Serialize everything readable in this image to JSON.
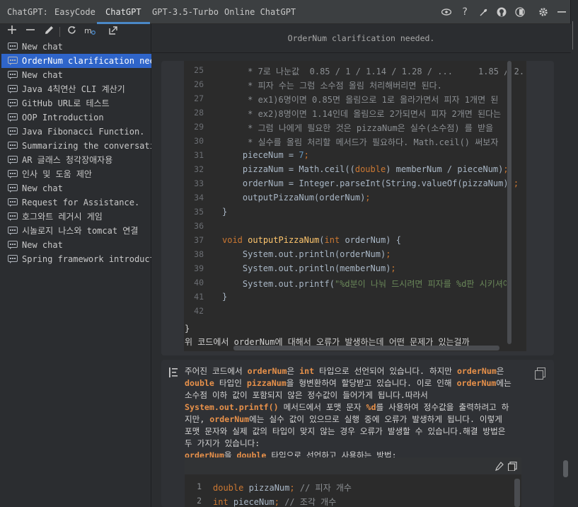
{
  "tabs": [
    "ChatGPT:",
    "EasyCode",
    "ChatGPT",
    "GPT-3.5-Turbo",
    "Online ChatGPT"
  ],
  "active_tab": 2,
  "icons": {
    "top": [
      "eye-icon",
      "help-icon",
      "wrench-icon",
      "github-icon",
      "plugin-icon",
      "gear-icon",
      "minimize-icon"
    ],
    "toolbar": [
      "add-icon",
      "remove-icon",
      "edit-icon",
      "refresh-icon",
      "settings-sync-icon",
      "export-icon"
    ]
  },
  "sidebar": {
    "items": [
      "New chat",
      "OrderNum clarification needed.",
      "New chat",
      "Java 4칙연산 CLI 계산기",
      "GitHub URL로 테스트",
      "OOP Introduction",
      "Java Fibonacci Function.",
      "Summarizing the conversation.",
      "AR 글래스 청각장애자용",
      "인사 및 도움 제안",
      "New chat",
      "Request for Assistance.",
      "호그와트 레거시 게임",
      "시놀로지 나스와 tomcat 연결",
      "New chat",
      "Spring framework introduction."
    ],
    "selected_index": 1
  },
  "main": {
    "header": "OrderNum clarification needed.",
    "code_lines": [
      {
        "n": "25",
        "t": "     * 7로 나눈값  0.85 / 1 / 1.14 / 1.28 / ...     1.85 / 2."
      },
      {
        "n": "26",
        "t": "     * 피자 수는 그럼 소수점 올림 처리해버리면 된다."
      },
      {
        "n": "27",
        "t": "     * ex1)6명이면 0.85면 올림으로 1로 올라가면서 피자 1개면 된"
      },
      {
        "n": "28",
        "t": "     * ex2)8명이면 1.14인데 올림으로 2가되면서 피자 2개면 된다는"
      },
      {
        "n": "29",
        "t": "     * 그럼 나에게 필요한 것은 pizzaNum은 실수(소수점) 를 받을 "
      },
      {
        "n": "30",
        "t": "     * 실수를 올림 처리할 메서드가 필요하다. Math.ceil() 써보자"
      },
      {
        "n": "31",
        "t": "    pieceNum = 7;"
      },
      {
        "n": "32",
        "t": "    pizzaNum = Math.ceil((double) memberNum / pieceNum);"
      },
      {
        "n": "33",
        "t": "    orderNum = Integer.parseInt(String.valueOf(pizzaNum));"
      },
      {
        "n": "34",
        "t": "    outputPizzaNum(orderNum);"
      },
      {
        "n": "35",
        "t": "}"
      },
      {
        "n": "36",
        "t": ""
      },
      {
        "n": "37",
        "t": "void outputPizzaNum(int orderNum) {"
      },
      {
        "n": "38",
        "t": "    System.out.println(orderNum);"
      },
      {
        "n": "39",
        "t": "    System.out.println(memberNum);"
      },
      {
        "n": "40",
        "t": "    System.out.printf(\"%d분이 나눠 드시려면 피자를 %d판 시키셔야"
      },
      {
        "n": "41",
        "t": "}"
      },
      {
        "n": "42",
        "t": ""
      }
    ],
    "closing_brace": "}",
    "question": "위 코드에서 orderNum에 대해서 오류가 발생하는데 어떤 문제가 있는걸까",
    "answer_segments": [
      {
        "t": "주어진 코드에서 ",
        "h": false
      },
      {
        "t": "orderNum",
        "h": true
      },
      {
        "t": "은 ",
        "h": false
      },
      {
        "t": "int",
        "h": true
      },
      {
        "t": " 타입으로 선언되어 있습니다. 하지만 ",
        "h": false
      },
      {
        "t": "orderNum",
        "h": true
      },
      {
        "t": "은 ",
        "h": false
      },
      {
        "t": "double",
        "h": true
      },
      {
        "t": " 타입인 ",
        "h": false
      },
      {
        "t": "pizzaNum",
        "h": true
      },
      {
        "t": "을 형변환하여 할당받고 있습니다. 이로 인해 ",
        "h": false
      },
      {
        "t": "orderNum",
        "h": true
      },
      {
        "t": "에는 소수점 이하 값이 포함되지 않은 정수값이 들어가게 됩니다.따라서 ",
        "h": false
      },
      {
        "t": "System.out.printf()",
        "h": true
      },
      {
        "t": " 메서드에서 포맷 문자 ",
        "h": false
      },
      {
        "t": "%d",
        "h": true
      },
      {
        "t": "를 사용하여 정수값을 출력하려고 하지만, ",
        "h": false
      },
      {
        "t": "orderNum",
        "h": true
      },
      {
        "t": "에는 실수 값이 있으므로 실행 중에 오류가 발생하게 됩니다. 이렇게 포맷 문자와 실제 값의 타입이 맞지 않는 경우 오류가 발생할 수 있습니다.해결 방법은 두 가지가 있습니다:",
        "h": false
      }
    ],
    "answer_tail": [
      {
        "t": "orderNum",
        "h": true
      },
      {
        "t": "을 ",
        "h": false
      },
      {
        "t": "double",
        "h": true
      },
      {
        "t": " 타입으로 선언하고 사용하는 방법:",
        "h": false
      }
    ],
    "code2_lines": [
      {
        "n": "1",
        "t": "double pizzaNum; // 피자 개수"
      },
      {
        "n": "2",
        "t": "int pieceNum; // 조각 개수"
      }
    ]
  }
}
